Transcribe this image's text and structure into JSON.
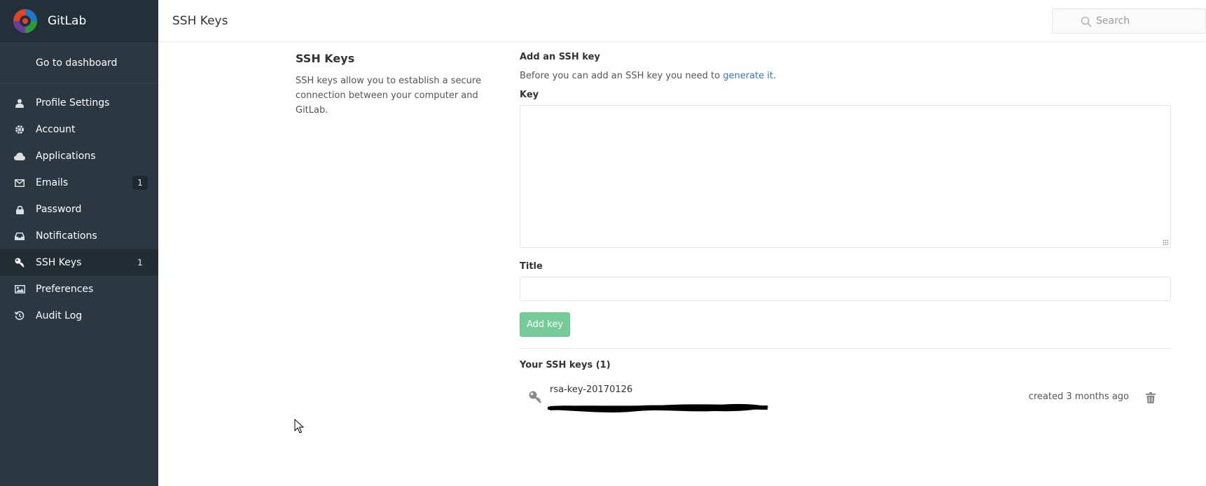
{
  "app": {
    "name": "GitLab"
  },
  "sidebar": {
    "dashboard_link": "Go to dashboard",
    "items": [
      {
        "label": "Profile Settings",
        "icon": "user-icon",
        "count": ""
      },
      {
        "label": "Account",
        "icon": "gear-icon",
        "count": ""
      },
      {
        "label": "Applications",
        "icon": "cloud-icon",
        "count": ""
      },
      {
        "label": "Emails",
        "icon": "envelope-icon",
        "count": "1"
      },
      {
        "label": "Password",
        "icon": "lock-icon",
        "count": ""
      },
      {
        "label": "Notifications",
        "icon": "inbox-icon",
        "count": ""
      },
      {
        "label": "SSH Keys",
        "icon": "key-icon",
        "count": "1",
        "active": true
      },
      {
        "label": "Preferences",
        "icon": "image-icon",
        "count": ""
      },
      {
        "label": "Audit Log",
        "icon": "history-icon",
        "count": ""
      }
    ]
  },
  "header": {
    "title": "SSH Keys",
    "search_placeholder": "Search"
  },
  "intro": {
    "heading": "SSH Keys",
    "description": "SSH keys allow you to establish a secure connection between your computer and GitLab."
  },
  "form": {
    "heading": "Add an SSH key",
    "help_prefix": "Before you can add an SSH key you need to ",
    "help_link": "generate it",
    "help_suffix": ".",
    "key_label": "Key",
    "key_value": "",
    "title_label": "Title",
    "title_value": "",
    "submit_label": "Add key"
  },
  "keys": {
    "heading": "Your SSH keys (1)",
    "items": [
      {
        "title": "rsa-key-20170126",
        "created": "created 3 months ago"
      }
    ]
  },
  "colors": {
    "sidebar_bg": "#2b3842",
    "link": "#3777b0",
    "button_green": "#75cc98"
  }
}
